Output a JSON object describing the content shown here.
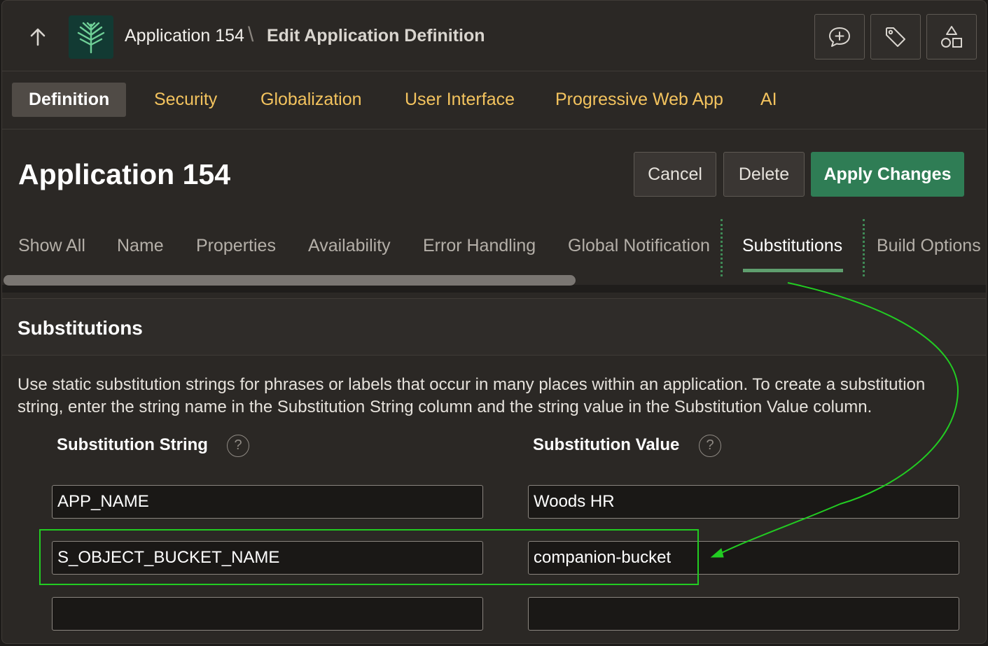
{
  "header": {
    "app_name": "Application 154",
    "separator": "\\",
    "page_title": "Edit Application Definition",
    "buttons": [
      {
        "icon": "add-comment-icon"
      },
      {
        "icon": "tag-icon"
      },
      {
        "icon": "shared-components-icon"
      }
    ]
  },
  "tabs": [
    "Definition",
    "Security",
    "Globalization",
    "User Interface",
    "Progressive Web App",
    "AI"
  ],
  "title": "Application 154",
  "actions": {
    "cancel": "Cancel",
    "delete": "Delete",
    "apply": "Apply Changes"
  },
  "region_tabs": [
    "Show All",
    "Name",
    "Properties",
    "Availability",
    "Error Handling",
    "Global Notification",
    "Substitutions",
    "Build Options"
  ],
  "region": {
    "title": "Substitutions",
    "help": "Use static substitution strings for phrases or labels that occur in many places within an application. To create a substitution string, enter the string name in the Substitution String column and the string value in the Substitution Value column.",
    "col_string": "Substitution String",
    "col_value": "Substitution Value",
    "help_glyph": "?",
    "rows": [
      {
        "string": "APP_NAME",
        "value": "Woods HR"
      },
      {
        "string": "S_OBJECT_BUCKET_NAME",
        "value": "companion-bucket"
      },
      {
        "string": "",
        "value": ""
      }
    ]
  },
  "colors": {
    "tab_text": "#f3c35e",
    "primary_button": "#2f7d55",
    "annotation": "#22cc22"
  }
}
